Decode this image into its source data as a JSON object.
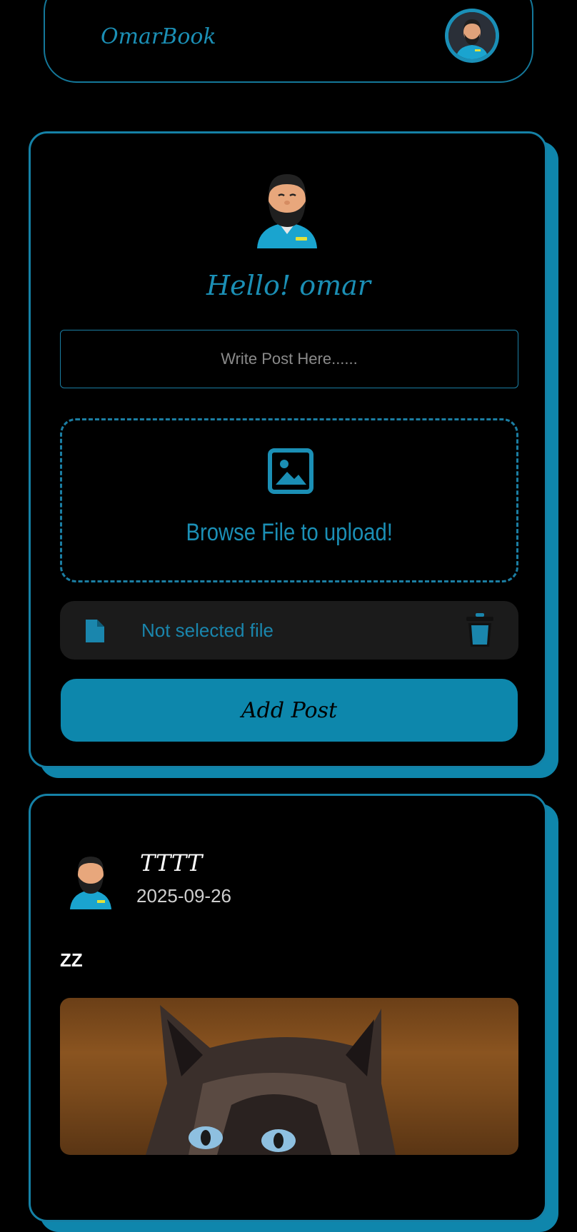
{
  "header": {
    "brand": "OmarBook",
    "avatar_icon": "user-avatar-icon"
  },
  "composer": {
    "greeting": "Hello! omar",
    "post_placeholder": "Write Post Here......",
    "upload_label": "Browse File to upload!",
    "upload_icon": "image-icon",
    "file_status": "Not selected file",
    "file_icon": "file-icon",
    "delete_icon": "trash-icon",
    "submit_label": "Add Post"
  },
  "post": {
    "username": "TTTT",
    "date": "2025-09-26",
    "text": "ZZ",
    "image_alt": "cat photo"
  },
  "colors": {
    "accent": "#0d87ac",
    "background": "#000000",
    "panel": "#1b1b1b"
  }
}
